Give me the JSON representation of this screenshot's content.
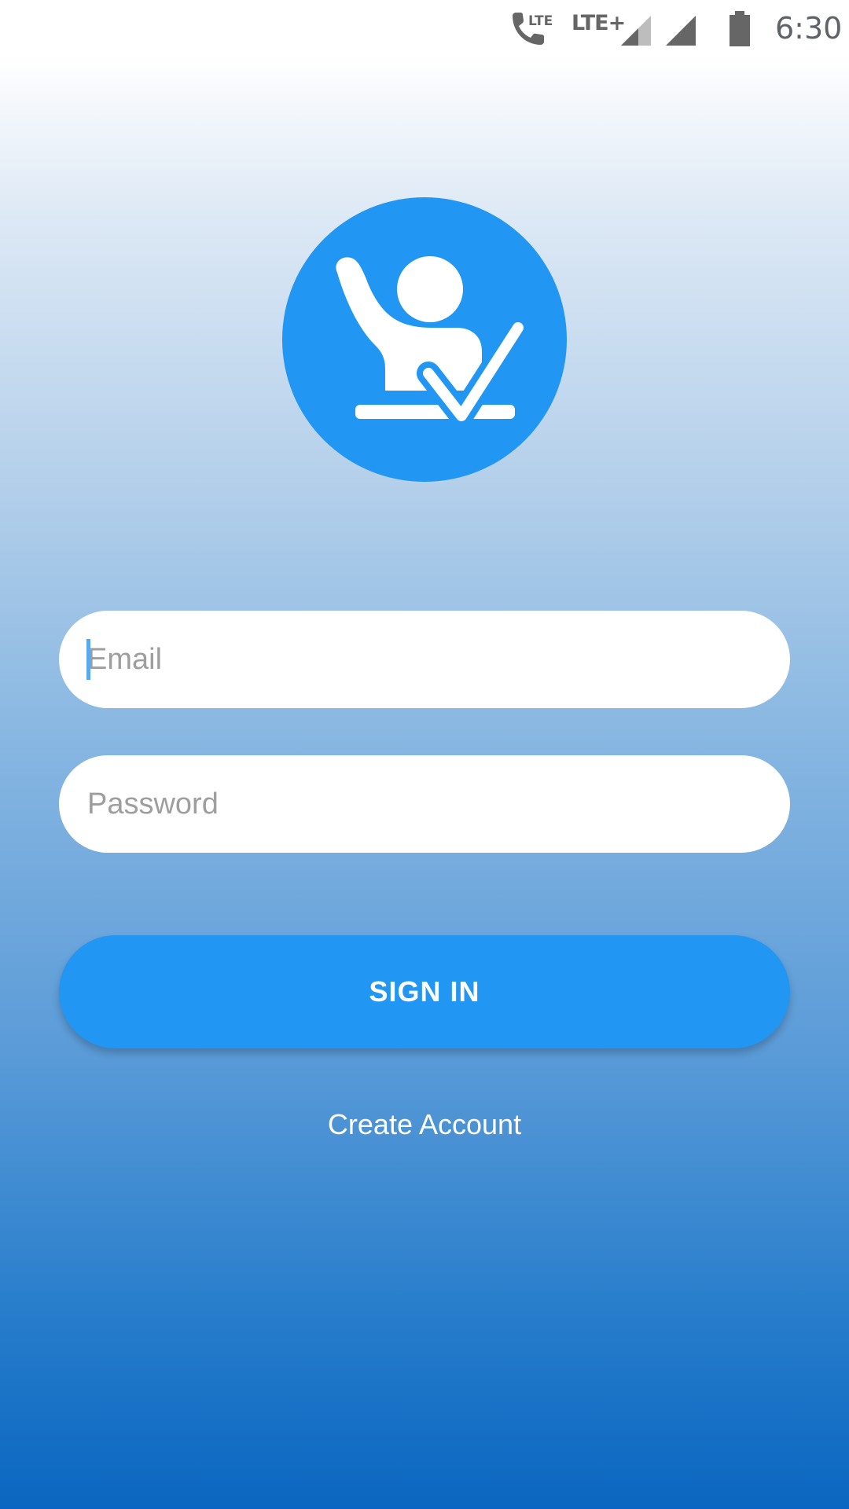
{
  "status_bar": {
    "network_label": "LTE+",
    "call_badge": "LTE",
    "time": "6:30"
  },
  "logo": {
    "icon": "raised-hand-check-icon",
    "color": "#2196f3"
  },
  "form": {
    "email_placeholder": "Email",
    "password_placeholder": "Password",
    "email_value": "",
    "password_value": ""
  },
  "actions": {
    "sign_in_label": "SIGN IN",
    "create_account_label": "Create Account"
  },
  "colors": {
    "accent": "#2196f3",
    "gradient_top": "#ffffff",
    "gradient_bottom": "#0a66c0"
  }
}
